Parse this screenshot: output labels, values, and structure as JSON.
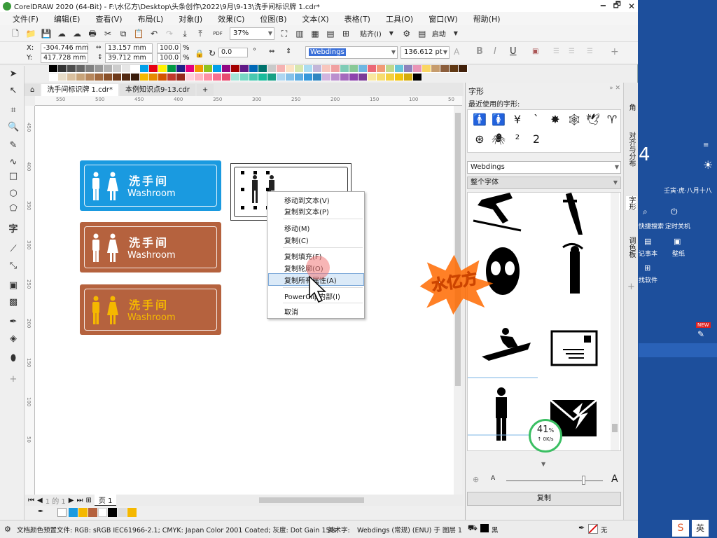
{
  "window": {
    "title": "CorelDRAW 2020 (64-Bit) - F:\\水亿方\\Desktop\\头条创作\\2022\\9月\\9-13\\洗手间标识牌 1.cdr*",
    "controls": [
      "🗕",
      "🗗",
      "✕"
    ]
  },
  "menu": [
    "文件(F)",
    "编辑(E)",
    "查看(V)",
    "布局(L)",
    "对象(J)",
    "效果(C)",
    "位图(B)",
    "文本(X)",
    "表格(T)",
    "工具(O)",
    "窗口(W)",
    "帮助(H)"
  ],
  "toolbar": {
    "zoom": "37%",
    "paste_label": "贴齐(I)",
    "launch_label": "启动",
    "pdf_label": "PDF"
  },
  "propbar": {
    "x_label": "X:",
    "y_label": "Y:",
    "x": "-304.746 mm",
    "y": "417.728 mm",
    "w": "13.157 mm",
    "h": "39.712 mm",
    "sx": "100.0",
    "sy": "100.0",
    "pct": "%",
    "rotation": "0.0",
    "font": "Webdings",
    "size": "136.612 pt",
    "bold": "B",
    "italic": "I",
    "underline": "U"
  },
  "tabs": [
    "洗手间标识牌 1.cdr*",
    "本例知识点9-13.cdr"
  ],
  "ruler": {
    "h_ticks": [
      "550",
      "500",
      "450",
      "400",
      "350",
      "300",
      "250",
      "200",
      "150",
      "100",
      "50"
    ],
    "v_ticks": [
      "450",
      "400",
      "350",
      "300",
      "250",
      "200",
      "150",
      "100",
      "50"
    ]
  },
  "signs": [
    {
      "cn": "洗手间",
      "en": "Washroom",
      "bg": "#1a9ae0",
      "figure": "#ffffff",
      "text": "#ffffff"
    },
    {
      "cn": "洗手间",
      "en": "Washroom",
      "bg": "#b5623e",
      "figure": "#ffffff",
      "text": "#ffffff"
    },
    {
      "cn": "洗手间",
      "en": "Washroom",
      "bg": "#b5623e",
      "figure": "#f5b800",
      "text": "#f5b800"
    }
  ],
  "context_menu": {
    "items": [
      "移动到文本(V)",
      "复制到文本(P)",
      "移动(M)",
      "复制(C)",
      "复制填充(F)",
      "复制轮廓(O)",
      "复制所有属性(A)",
      "PowerClip内部(I)",
      "取消"
    ],
    "highlighted": "复制所有属性(A)"
  },
  "watermark": "水亿方",
  "panel": {
    "title": "字形",
    "recent_label": "最近使用的字形:",
    "recent_glyphs": [
      "🚹",
      "🚺",
      "¥",
      "`",
      "✸",
      "🕸",
      "🕊",
      "♈",
      "⊛",
      "🕷",
      "²",
      "2"
    ],
    "font": "Webdings",
    "range": "整个字体",
    "copy_button": "复制",
    "speed_value": "41",
    "speed_unit": "%",
    "speed_rate": "↑ 0K/s"
  },
  "side_tabs": [
    "角",
    "对齐与分布",
    "字形",
    "调色板"
  ],
  "page": {
    "indicator": "1 的 1",
    "label": "页 1"
  },
  "status": {
    "doc_color": "文档颜色预置文件: RGB: sRGB IEC61966-2.1; CMYK: Japan Color 2001 Coated; 灰度: Dot Gain 15%",
    "art_text": "美术字:",
    "art_detail": "Webdings (常规) (ENU) 于 图层 1",
    "fill_label": "黑",
    "outline_label": "无"
  },
  "desktop": {
    "big_digit": "4",
    "date": "壬寅·虎·八月十八",
    "items": [
      "快捷搜索",
      "定时关机",
      "记事本",
      "壁纸",
      "找软件"
    ],
    "new_badge": "NEW",
    "ime": "英"
  },
  "colors": {
    "accent_blue": "#1a9ae0",
    "brown": "#b5623e",
    "gold": "#f5b800",
    "desktop_bg": "#1d4f9c",
    "menu_highlight": "#dbeaf8"
  }
}
